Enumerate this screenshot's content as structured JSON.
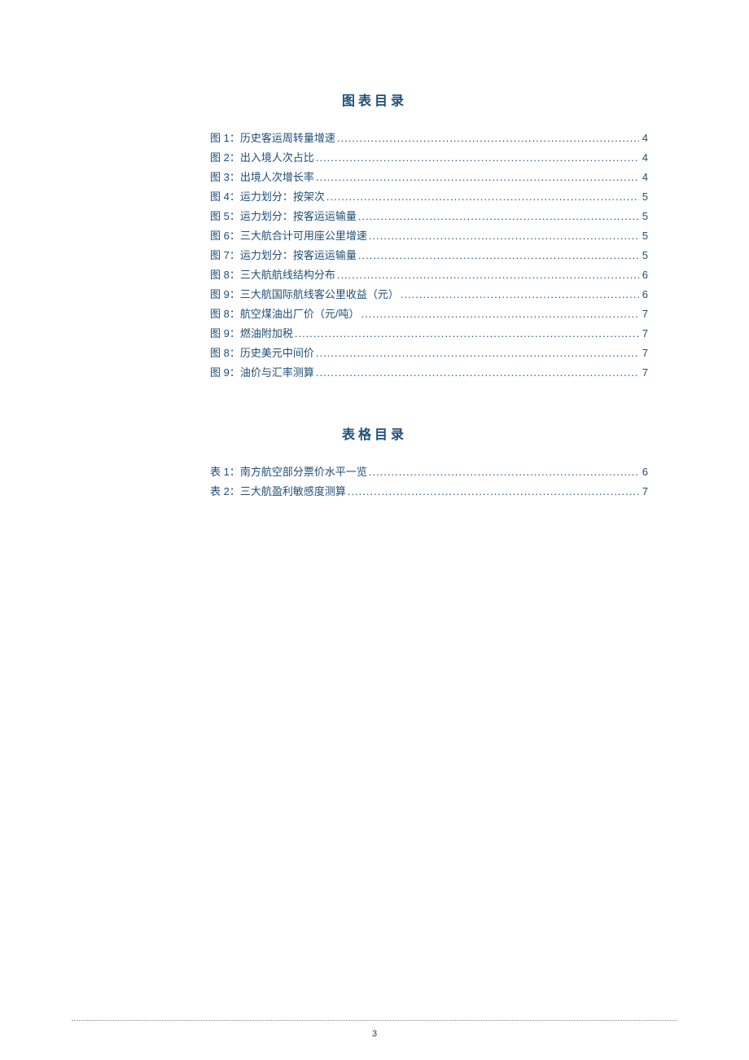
{
  "sections": [
    {
      "title": "图表目录",
      "entries": [
        {
          "label": "图 1：历史客运周转量增速",
          "page": "4"
        },
        {
          "label": "图 2：出入境人次占比",
          "page": "4"
        },
        {
          "label": "图 3：出境人次增长率",
          "page": "4"
        },
        {
          "label": "图 4：运力划分：按架次",
          "page": "5"
        },
        {
          "label": "图 5：运力划分：按客运运输量",
          "page": "5"
        },
        {
          "label": "图 6：三大航合计可用座公里增速",
          "page": "5"
        },
        {
          "label": "图 7：运力划分：按客运运输量",
          "page": "5"
        },
        {
          "label": "图 8：三大航航线结构分布",
          "page": "6"
        },
        {
          "label": "图 9：三大航国际航线客公里收益（元）",
          "page": "6"
        },
        {
          "label": "图 8：航空煤油出厂价（元/吨）",
          "page": "7"
        },
        {
          "label": "图 9：燃油附加税",
          "page": "7"
        },
        {
          "label": "图 8：历史美元中间价",
          "page": "7"
        },
        {
          "label": "图 9：油价与汇率测算",
          "page": "7"
        }
      ]
    },
    {
      "title": "表格目录",
      "entries": [
        {
          "label": "表 1：南方航空部分票价水平一览",
          "page": "6"
        },
        {
          "label": "表 2：三大航盈利敏感度测算",
          "page": "7"
        }
      ]
    }
  ],
  "page_number": "3"
}
